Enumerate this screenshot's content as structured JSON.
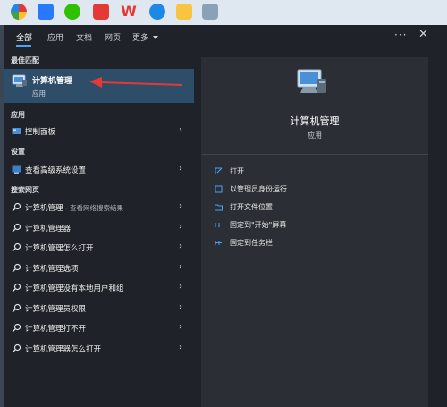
{
  "tabs": {
    "all": "全部",
    "apps": "应用",
    "docs": "文档",
    "web": "网页",
    "more": "更多"
  },
  "sections": {
    "best_match": "最佳匹配",
    "apps": "应用",
    "settings": "设置",
    "search_web": "搜索网页"
  },
  "best_match": {
    "title": "计算机管理",
    "subtitle": "应用"
  },
  "app_items": [
    {
      "label": "控制面板",
      "icon": "control-panel-icon"
    }
  ],
  "setting_items": [
    {
      "label": "查看高级系统设置",
      "icon": "settings-icon"
    }
  ],
  "web_items": [
    {
      "label": "计算机管理",
      "suffix": " - 查看网络搜索结果"
    },
    {
      "label": "计算机管理器",
      "suffix": ""
    },
    {
      "label": "计算机管理怎么打开",
      "suffix": ""
    },
    {
      "label": "计算机管理选项",
      "suffix": ""
    },
    {
      "label": "计算机管理没有本地用户和组",
      "suffix": ""
    },
    {
      "label": "计算机管理员权限",
      "suffix": ""
    },
    {
      "label": "计算机管理打不开",
      "suffix": ""
    },
    {
      "label": "计算机管理器怎么打开",
      "suffix": ""
    }
  ],
  "detail": {
    "title": "计算机管理",
    "subtitle": "应用",
    "actions": [
      {
        "label": "打开",
        "icon": "open-icon"
      },
      {
        "label": "以管理员身份运行",
        "icon": "admin-shield-icon"
      },
      {
        "label": "打开文件位置",
        "icon": "folder-icon"
      },
      {
        "label": "固定到\"开始\"屏幕",
        "icon": "pin-icon"
      },
      {
        "label": "固定到任务栏",
        "icon": "pin-icon"
      }
    ]
  },
  "colors": {
    "accent": "#4ba3f5",
    "selected": "#2e4d69",
    "annotation_arrow": "#e53935"
  }
}
